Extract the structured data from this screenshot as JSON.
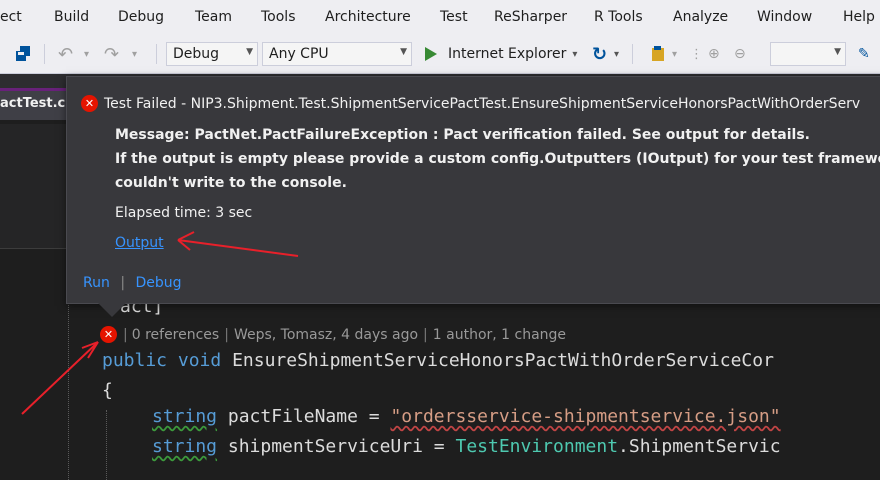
{
  "menu": {
    "items": [
      "ect",
      "Build",
      "Debug",
      "Team",
      "Tools",
      "Architecture",
      "Test",
      "ReSharper",
      "R Tools",
      "Analyze",
      "Window",
      "Help"
    ]
  },
  "toolbar": {
    "config": "Debug",
    "platform": "Any CPU",
    "run_target": "Internet Explorer"
  },
  "doc_tab": {
    "title": "actTest.c"
  },
  "popup": {
    "title": "Test Failed - NIP3.Shipment.Test.ShipmentServicePactTest.EnsureShipmentServiceHonorsPactWithOrderServ",
    "message_line1": "Message: PactNet.PactFailureException : Pact verification failed. See output for details.",
    "message_line2": "If the output is empty please provide a custom config.Outputters (IOutput) for your test framework",
    "message_line3": "couldn't write to the console.",
    "elapsed": "Elapsed time: 3 sec",
    "output_link": "Output",
    "run_link": "Run",
    "separator": "|",
    "debug_link": "Debug"
  },
  "editor": {
    "attribute_line": "act]",
    "codelens": {
      "references": "0 references",
      "sep": "|",
      "author_info": "Weps, Tomasz, 4 days ago",
      "changes": "1 author, 1 change"
    },
    "line_signature": {
      "kw1": "public",
      "kw2": "void",
      "name": "EnsureShipmentServiceHonorsPactWithOrderServiceCor"
    },
    "line_brace": "{",
    "line_pact": {
      "type": "string",
      "name": "pactFileName",
      "eq": "=",
      "value": "\"ordersservice-shipmentservice.json\""
    },
    "line_uri": {
      "type": "string",
      "name": "shipmentServiceUri",
      "eq": "=",
      "cls": "TestEnvironment",
      "rest": ".ShipmentServic"
    }
  },
  "colors": {
    "accent_red": "#e51400",
    "link_blue": "#3794ff",
    "annotation_red": "#e8202a",
    "keyword": "#569cd6",
    "string": "#d69d85",
    "type": "#4ec9b0"
  }
}
